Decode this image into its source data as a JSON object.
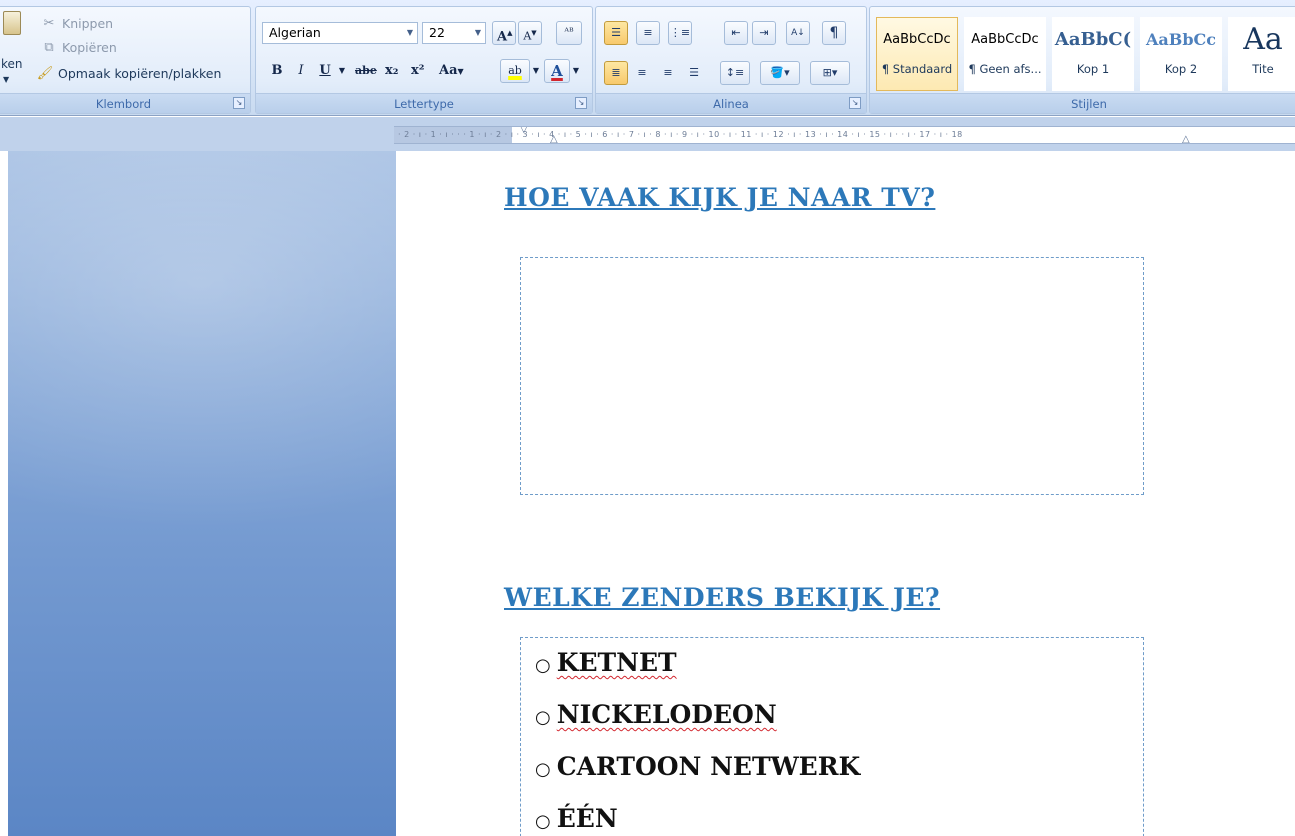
{
  "clipboard": {
    "paste_label": "ken",
    "cut_label": "Knippen",
    "copy_label": "Kopiëren",
    "format_painter_label": "Opmaak kopiëren/plakken",
    "group_label": "Klembord"
  },
  "font": {
    "family_value": "Algerian",
    "size_value": "22",
    "grow_label": "A",
    "shrink_label": "A",
    "clear_label": "ᴬᴮ",
    "bold_label": "B",
    "italic_label": "I",
    "underline_label": "U",
    "strike_label": "abe",
    "subscript_label": "x₂",
    "superscript_label": "x²",
    "case_label": "Aa",
    "highlight_label": "ab",
    "color_label": "A",
    "group_label": "Lettertype",
    "highlight_color": "#ffff00",
    "font_color": "#d2262e"
  },
  "paragraph": {
    "group_label": "Alinea",
    "pilcrow_label": "¶",
    "sort_label": "A↓"
  },
  "styles": {
    "group_label": "Stijlen",
    "items": [
      {
        "sample": "AaBbCcDc",
        "name": "¶ Standaard"
      },
      {
        "sample": "AaBbCcDc",
        "name": "¶ Geen afs..."
      },
      {
        "sample": "AaBbC(",
        "name": "Kop 1"
      },
      {
        "sample": "AaBbCc",
        "name": "Kop 2"
      },
      {
        "sample": "Aa",
        "name": "Tite"
      }
    ]
  },
  "ruler": {
    "ticks": "· 2 · ı · 1 · ı ·    · · 1 · ı · 2 · ı · 3 · ı · 4 · ı · 5 · ı · 6 · ı · 7 · ı · 8 · ı · 9 · ı · 10 · ı · 11 · ı · 12 · ı · 13 · ı · 14 · ı · 15 · ı ·   · ı · 17 · ı · 18"
  },
  "document": {
    "heading1": "HOE VAAK KIJK JE NAAR TV?",
    "heading2": "WELKE ZENDERS BEKIJK JE?",
    "bullet_char": "○",
    "channels": [
      {
        "label": "KETNET",
        "misspelled": true
      },
      {
        "label": "NICKELODEON",
        "misspelled": true
      },
      {
        "label": "CARTOON NETWERK",
        "misspelled": false
      },
      {
        "label": "ÉÉN",
        "misspelled": false
      }
    ]
  },
  "colors": {
    "heading": "#2c78b9",
    "ribbon_label": "#3e6aaa",
    "textbox_border": "#6f9cc9"
  }
}
